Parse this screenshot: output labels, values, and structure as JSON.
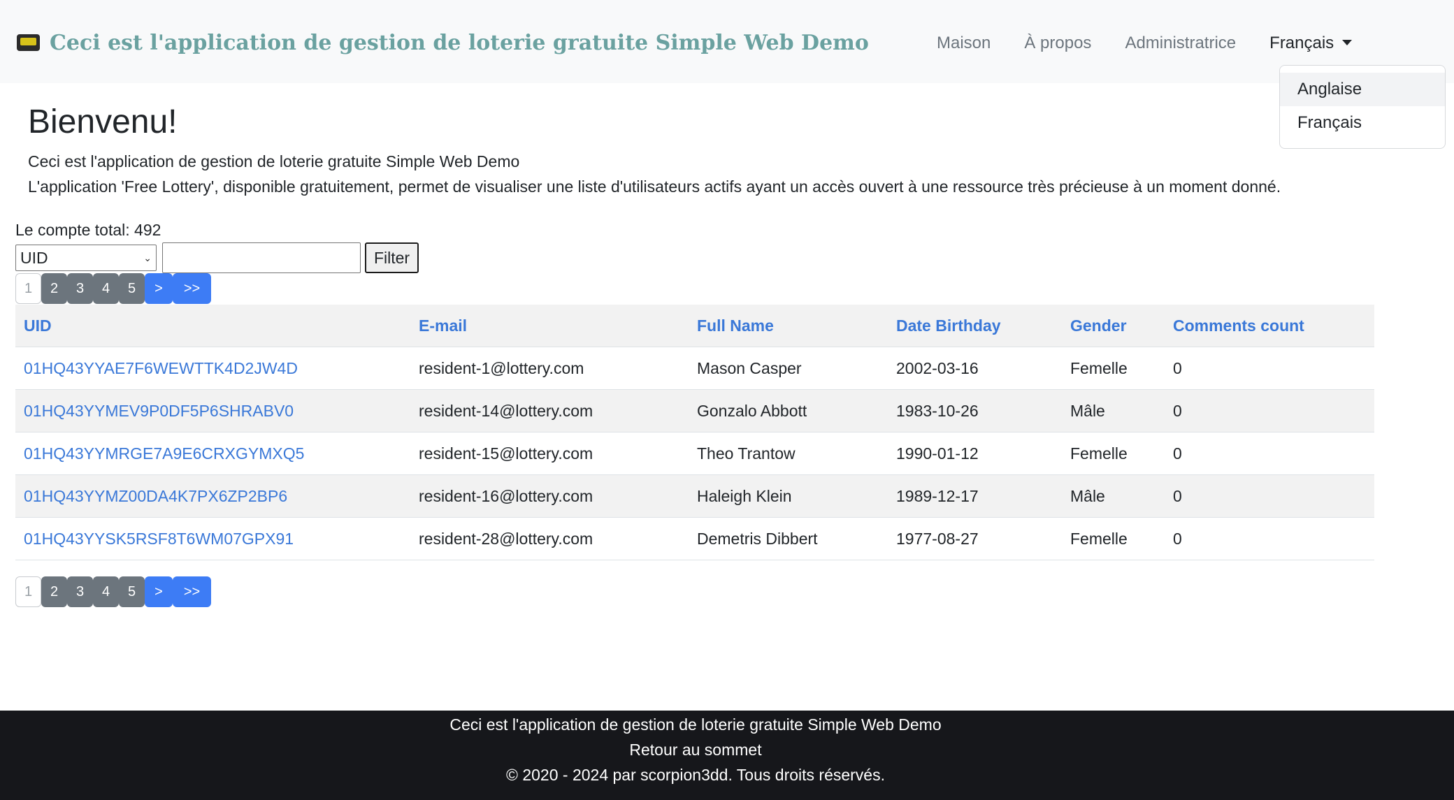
{
  "navbar": {
    "brand_title": "Ceci est l'application de gestion de loterie gratuite Simple Web Demo",
    "links": [
      "Maison",
      "À propos",
      "Administratrice"
    ],
    "language_toggle": "Français",
    "dropdown": [
      "Anglaise",
      "Français"
    ]
  },
  "main": {
    "title": "Bienvenu!",
    "intro_1": "Ceci est l'application de gestion de loterie gratuite Simple Web Demo",
    "intro_2": "L'application 'Free Lottery', disponible gratuitement, permet de visualiser une liste d'utilisateurs actifs ayant un accès ouvert à une ressource très précieuse à un moment donné.",
    "total_count": "Le compte total: 492",
    "filter": {
      "field_selected": "UID",
      "input_value": "",
      "button_label": "Filter"
    },
    "pagination": [
      "1",
      "2",
      "3",
      "4",
      "5",
      ">",
      ">>"
    ],
    "table": {
      "headers": [
        "UID",
        "E-mail",
        "Full Name",
        "Date Birthday",
        "Gender",
        "Comments count"
      ],
      "rows": [
        [
          "01HQ43YYAE7F6WEWTTK4D2JW4D",
          "resident-1@lottery.com",
          "Mason Casper",
          "2002-03-16",
          "Femelle",
          "0"
        ],
        [
          "01HQ43YYMEV9P0DF5P6SHRABV0",
          "resident-14@lottery.com",
          "Gonzalo Abbott",
          "1983-10-26",
          "Mâle",
          "0"
        ],
        [
          "01HQ43YYMRGE7A9E6CRXGYMXQ5",
          "resident-15@lottery.com",
          "Theo Trantow",
          "1990-01-12",
          "Femelle",
          "0"
        ],
        [
          "01HQ43YYMZ00DA4K7PX6ZP2BP6",
          "resident-16@lottery.com",
          "Haleigh Klein",
          "1989-12-17",
          "Mâle",
          "0"
        ],
        [
          "01HQ43YYSK5RSF8T6WM07GPX91",
          "resident-28@lottery.com",
          "Demetris Dibbert",
          "1977-08-27",
          "Femelle",
          "0"
        ]
      ]
    }
  },
  "footer": {
    "line_1": "Ceci est l'application de gestion de loterie gratuite Simple Web Demo",
    "line_2": "Retour au sommet",
    "line_3": "© 2020 - 2024 par scorpion3dd. Tous droits réservés."
  },
  "icons": {
    "brand": "ticket-icon"
  }
}
